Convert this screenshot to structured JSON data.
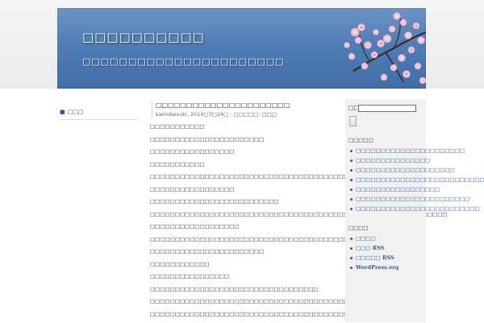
{
  "header": {
    "site_title": "□□□□□□□□□□",
    "site_description": "□□□□□□□□□□□□□□□□□□□□□□"
  },
  "left_nav": {
    "items": [
      {
        "label": "□□□"
      }
    ]
  },
  "post": {
    "title": "□□□□□□□□□□□□□□□□□□□□□□",
    "author": "kamidaisuki",
    "meta_sep1": ", ",
    "date": "2014□7□24□",
    "meta_sep2": " · □□□□□: ",
    "category": "□□□",
    "paragraphs": [
      "□□□□□□□□□□□",
      "□□□□□□□□□□□□□□□□□□□□□□□",
      "□□□□□□□□□□□□□□□□□",
      "□□□□□□□□□□□",
      "□□□□□□□□□□□□□□□□□□□□□□□□□□□□□□□□□□□□□□□□□□□□□□□□□□□□□□□",
      "□□□□□□□□□□□□□□□□□",
      "□□□□□□□□□□□□□□□□□□□□□□□□□□",
      "□□□□□□□□□□□□□□□□□□□□□□□□□□□□□□□□□□□□□□□□□□□□□□□□□□□□□□□□□□□□",
      "□□□□□□□□□□□□□□□□□□",
      "□□□□□□□□□□□□□□□□□□□□□□□□□□□□□□□□□□□□□□□□□□□□□",
      "□□□□□□□□□□□□□□□□□□□□□□□",
      "□□□□□□□□□□□□",
      "□□□□□□□□□□□□□□□□",
      "□□□□□□□□□□□□□□□□□□□□□□□□□□□□□□□□□□",
      "□□□□□□□□□□□□□□□□□□□□□□□□□□□□□□□□□□□□□□□□□□□□□□□□□",
      "□□□□□□□□□□□□□□□□□□□□□□□□□□□□□□□□□□□□□□□□□□□□□□□□□□"
    ]
  },
  "sidebar": {
    "search": {
      "label": "□□:",
      "value": "",
      "button_label": ""
    },
    "recent_posts": {
      "heading": "□□□□□",
      "items": [
        "□□□□□□□□□□□□□□□□□□□□□□",
        "□□□□□□□□□□□□□□□",
        "□□□□□□□□□□□□□□□□□□□□",
        "□□□□□□□□□□□□□□□□□□□□□□□□□□□□□□",
        "□□□□□□□□□□□□□□□□□",
        "□□□□□□□□□□□□□□□□□□□□□□□",
        "□□□□□□□□□□□□□□□□□□□□□□□□□"
      ]
    },
    "meta": {
      "heading": "□□□□",
      "items": [
        "□□□□",
        "□□□ RSS",
        "□□□□□ RSS",
        "WordPress.org"
      ]
    }
  }
}
